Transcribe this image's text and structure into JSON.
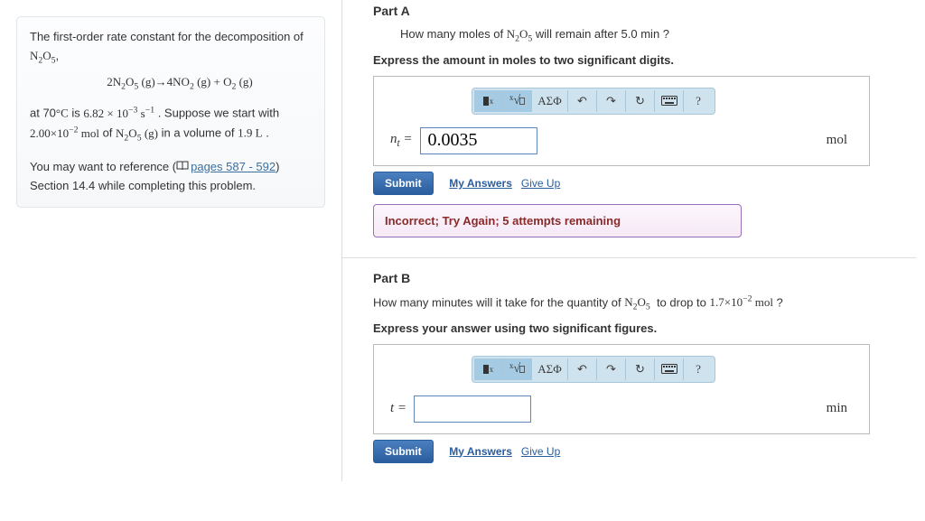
{
  "intro": {
    "line1_pre": "The first-order rate constant for the decomposition of ",
    "line1_chem": "N₂O₅",
    "line1_post": ",",
    "equation": "2N₂O₅ (g)→4NO₂ (g) + O₂ (g)",
    "line2_pre": "at 70°C is ",
    "line2_val": "6.82 × 10⁻³ s⁻¹",
    "line2_post": " . Suppose we start with ",
    "line2_amt": "2.00×10⁻² mol",
    "line2_of": " of N₂O₅ (g) in a volume of 1.9 L .",
    "ref_pre": "You may want to reference (",
    "ref_link": "pages 587 - 592",
    "ref_post": ") Section 14.4 while completing this problem."
  },
  "partA": {
    "label": "Part A",
    "question_pre": "How many moles of ",
    "question_post": " will remain after 5.0 min ?",
    "chem": "N₂O₅",
    "instr": "Express the amount in moles to two significant digits.",
    "var": "nₜ",
    "value": "0.0035",
    "unit": "mol",
    "submit": "Submit",
    "my_answers": "My Answers",
    "give_up": "Give Up",
    "feedback": "Incorrect; Try Again; 5 attempts remaining"
  },
  "partB": {
    "label": "Part B",
    "question": "How many minutes will it take for the quantity of N₂O₅  to drop to 1.7×10⁻² mol ?",
    "instr": "Express your answer using two significant figures.",
    "var": "t",
    "value": "",
    "unit": "min",
    "submit": "Submit",
    "my_answers": "My Answers",
    "give_up": "Give Up"
  },
  "toolbar": {
    "rect": "▮",
    "frac": "√",
    "greek": "ΑΣΦ",
    "undo": "↶",
    "redo": "↷",
    "reset": "↻",
    "keyboard": "⌨",
    "help": "?"
  }
}
